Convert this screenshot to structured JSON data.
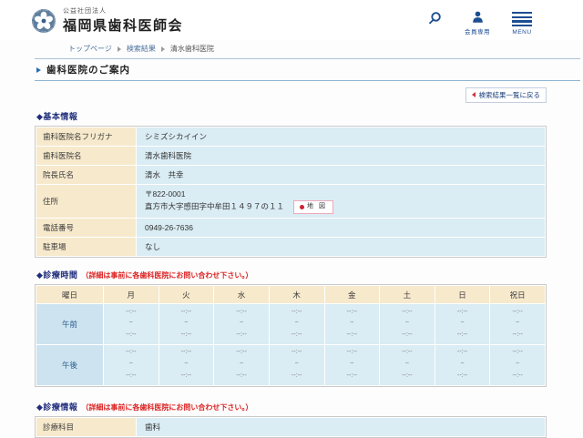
{
  "header": {
    "org_type": "公益社団法人",
    "org_name": "福岡県歯科医師会",
    "member_label": "会員専用",
    "menu_label": "MENU"
  },
  "breadcrumb": {
    "items": [
      "トップページ",
      "検索結果",
      "清水歯科医院"
    ]
  },
  "page": {
    "title": "歯科医院のご案内",
    "back_link": "検索結果一覧に戻る"
  },
  "basic_info": {
    "title": "◆基本情報",
    "rows": [
      {
        "label": "歯科医院名フリガナ",
        "value": "シミズシカイイン"
      },
      {
        "label": "歯科医院名",
        "value": "清水歯科医院"
      },
      {
        "label": "院長氏名",
        "value": "清水　共幸"
      },
      {
        "label": "住所",
        "postal": "〒822-0001",
        "address": "直方市大字感田字中牟田１４９７の１１",
        "map_label": "地 図"
      },
      {
        "label": "電話番号",
        "value": "0949-26-7636"
      },
      {
        "label": "駐車場",
        "value": "なし"
      }
    ]
  },
  "hours": {
    "title": "◆診療時間",
    "note": "（詳細は事前に各歯科医院にお問い合わせ下さい。）",
    "day_header": "曜日",
    "days": [
      "月",
      "火",
      "水",
      "木",
      "金",
      "土",
      "日",
      "祝日"
    ],
    "rows": [
      {
        "label": "午前"
      },
      {
        "label": "午後"
      }
    ],
    "empty_time": "--:--",
    "tilde": "~"
  },
  "clinic_info": {
    "title": "◆診療情報",
    "note": "（詳細は事前に各歯科医院にお問い合わせ下さい。）",
    "rows": [
      {
        "label": "診療科目",
        "value": "歯科"
      }
    ]
  },
  "colors": {
    "accent_navy": "#1c4e92",
    "section_title_navy": "#1f2d7b",
    "note_red": "#dd2222",
    "label_beige": "#f7e9cc",
    "value_blue": "#daecf4",
    "period_blue": "#cde4f0",
    "rule_blue": "#aac4d8",
    "back_arrow_red": "#cc3344",
    "map_red": "#cc2233"
  }
}
